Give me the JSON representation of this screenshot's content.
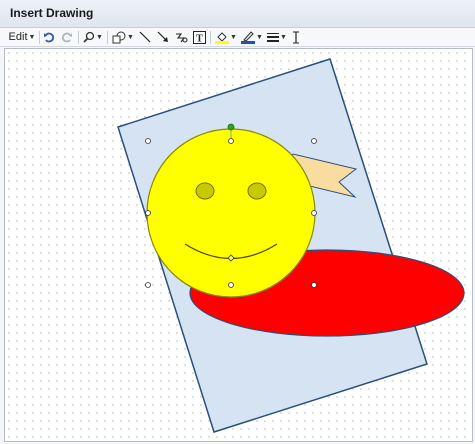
{
  "window": {
    "title": "Insert Drawing"
  },
  "toolbar": {
    "edit_label": "Edit",
    "items": [
      {
        "icon": "undo-icon"
      },
      {
        "icon": "redo-icon"
      },
      {
        "icon": "zoom-icon"
      },
      {
        "icon": "shape-icon"
      },
      {
        "icon": "line-icon"
      },
      {
        "icon": "arrow-icon"
      },
      {
        "icon": "scribble-icon"
      },
      {
        "icon": "text-box-icon"
      },
      {
        "icon": "fill-color-icon"
      },
      {
        "icon": "line-color-icon"
      },
      {
        "icon": "line-weight-icon"
      },
      {
        "icon": "text-cursor-icon"
      }
    ],
    "fill_color": "#ffff00",
    "line_color": "#1f4fbf",
    "text_box_glyph": "T"
  },
  "colors": {
    "rect_fill": "#d6e3f3",
    "rect_stroke": "#2a4f7a",
    "ellipse_fill": "#ff0000",
    "face_fill": "#ffff00",
    "eye_fill": "#c9c900",
    "banner_fill": "#f8dca0",
    "selection_handle": "#22aa22"
  }
}
